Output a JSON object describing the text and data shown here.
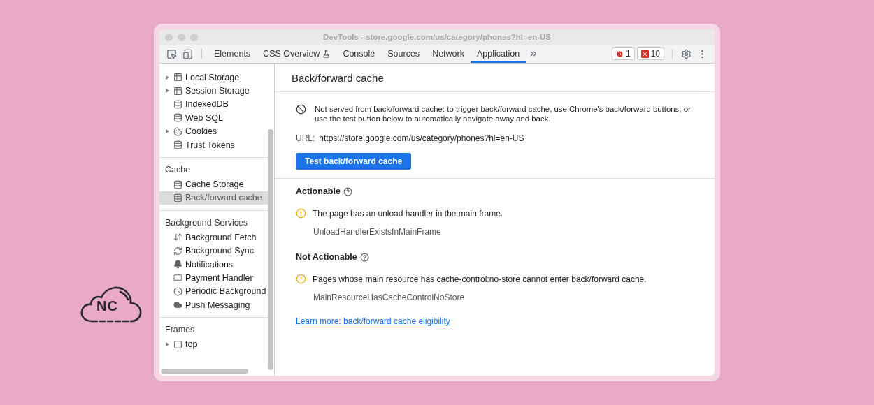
{
  "window": {
    "title": "DevTools - store.google.com/us/category/phones?hl=en-US"
  },
  "toolbar": {
    "tabs": [
      {
        "label": "Elements",
        "selected": false,
        "experimental": false
      },
      {
        "label": "CSS Overview",
        "selected": false,
        "experimental": true
      },
      {
        "label": "Console",
        "selected": false,
        "experimental": false
      },
      {
        "label": "Sources",
        "selected": false,
        "experimental": false
      },
      {
        "label": "Network",
        "selected": false,
        "experimental": false
      },
      {
        "label": "Application",
        "selected": true,
        "experimental": false
      }
    ],
    "errors": "1",
    "issues": "10"
  },
  "sidebar": {
    "sections": [
      {
        "items": [
          {
            "label": "Local Storage",
            "kind": "grid",
            "expandable": true,
            "selected": false
          },
          {
            "label": "Session Storage",
            "kind": "grid",
            "expandable": true,
            "selected": false
          },
          {
            "label": "IndexedDB",
            "kind": "database",
            "expandable": false,
            "selected": false
          },
          {
            "label": "Web SQL",
            "kind": "database",
            "expandable": false,
            "selected": false
          },
          {
            "label": "Cookies",
            "kind": "cookie",
            "expandable": true,
            "selected": false
          },
          {
            "label": "Trust Tokens",
            "kind": "database",
            "expandable": false,
            "selected": false
          }
        ]
      },
      {
        "heading": "Cache",
        "items": [
          {
            "label": "Cache Storage",
            "kind": "database",
            "expandable": false,
            "selected": false
          },
          {
            "label": "Back/forward cache",
            "kind": "database",
            "expandable": false,
            "selected": true
          }
        ]
      },
      {
        "heading": "Background Services",
        "items": [
          {
            "label": "Background Fetch",
            "kind": "updown",
            "expandable": false,
            "selected": false
          },
          {
            "label": "Background Sync",
            "kind": "sync",
            "expandable": false,
            "selected": false
          },
          {
            "label": "Notifications",
            "kind": "bell",
            "expandable": false,
            "selected": false
          },
          {
            "label": "Payment Handler",
            "kind": "card",
            "expandable": false,
            "selected": false
          },
          {
            "label": "Periodic Background",
            "kind": "clock",
            "expandable": false,
            "selected": false
          },
          {
            "label": "Push Messaging",
            "kind": "cloud",
            "expandable": false,
            "selected": false
          }
        ]
      },
      {
        "heading": "Frames",
        "items": [
          {
            "label": "top",
            "kind": "frame",
            "expandable": true,
            "selected": false
          }
        ]
      }
    ]
  },
  "main": {
    "title": "Back/forward cache",
    "notice": "Not served from back/forward cache: to trigger back/forward cache, use Chrome's back/forward buttons, or use the test button below to automatically navigate away and back.",
    "url_label": "URL:",
    "url": "https://store.google.com/us/category/phones?hl=en-US",
    "test_button": "Test back/forward cache",
    "groups": [
      {
        "heading": "Actionable",
        "reasons": [
          {
            "text": "The page has an unload handler in the main frame.",
            "code": "UnloadHandlerExistsInMainFrame"
          }
        ]
      },
      {
        "heading": "Not Actionable",
        "reasons": [
          {
            "text": "Pages whose main resource has cache-control:no-store cannot enter back/forward cache.",
            "code": "MainResourceHasCacheControlNoStore"
          }
        ]
      }
    ],
    "learn_more": "Learn more: back/forward cache eligibility"
  },
  "logo": {
    "text": "NC"
  }
}
